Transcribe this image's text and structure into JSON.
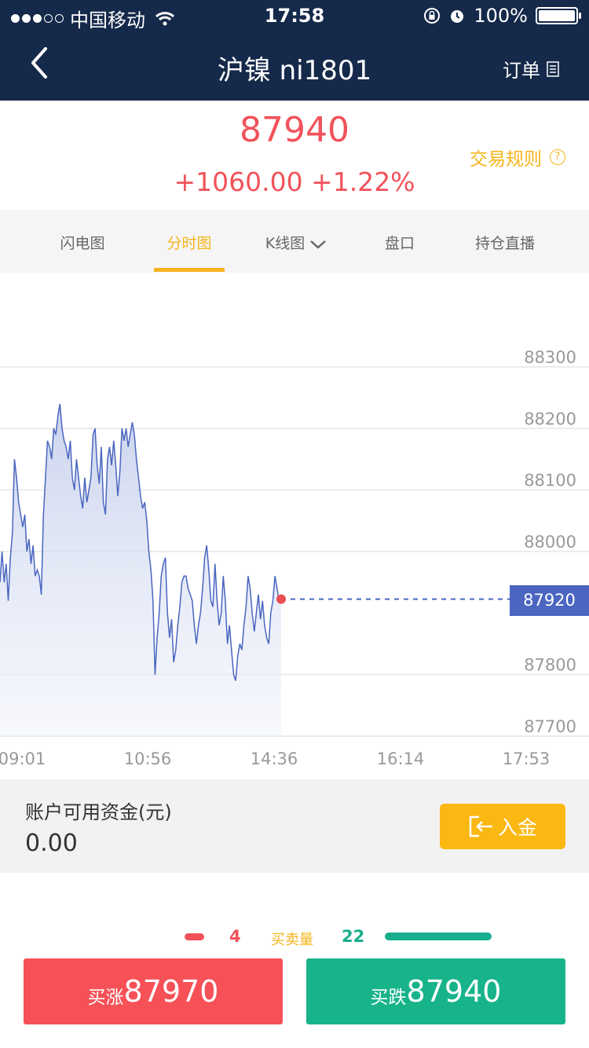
{
  "status_bar": {
    "carrier": "中国移动",
    "time": "17:58",
    "battery": "100%",
    "signal_bars_filled": 3,
    "signal_bars_total": 5
  },
  "nav": {
    "title": "沪镍 ni1801",
    "orders_label": "订单"
  },
  "quote": {
    "price": "87940",
    "change": "+1060.00 +1.22%",
    "rules_label": "交易规则",
    "accent_color": "#f2525a"
  },
  "tabs": [
    {
      "label": "闪电图",
      "active": false
    },
    {
      "label": "分时图",
      "active": true
    },
    {
      "label": "K线图",
      "active": false
    },
    {
      "label": "盘口",
      "active": false
    },
    {
      "label": "持仓直播",
      "active": false
    }
  ],
  "chart_data": {
    "type": "area",
    "y_ticks": [
      "88300",
      "88200",
      "88100",
      "88000",
      "87800",
      "87700"
    ],
    "x_ticks": [
      "09:01",
      "10:56",
      "14:36",
      "16:14",
      "17:53"
    ],
    "ylim": [
      87700,
      88300
    ],
    "current_price_label": "87920",
    "current_price": 87920,
    "series": [
      {
        "values": [
          87950,
          88000,
          87950,
          87980,
          87920,
          87990,
          88030,
          88150,
          88120,
          88080,
          88060,
          88040,
          88060,
          88000,
          88020,
          87980,
          88010,
          87960,
          87970,
          87960,
          87930,
          88060,
          88120,
          88180,
          88170,
          88150,
          88200,
          88190,
          88220,
          88240,
          88200,
          88180,
          88170,
          88150,
          88180,
          88120,
          88100,
          88150,
          88120,
          88090,
          88070,
          88120,
          88080,
          88100,
          88120,
          88190,
          88200,
          88140,
          88110,
          88170,
          88080,
          88060,
          88150,
          88170,
          88140,
          88180,
          88140,
          88090,
          88130,
          88200,
          88180,
          88200,
          88170,
          88190,
          88210,
          88190,
          88150,
          88120,
          88090,
          88070,
          88080,
          88050,
          88000,
          87970,
          87920,
          87800,
          87860,
          87900,
          87960,
          87980,
          87990,
          87900,
          87860,
          87890,
          87820,
          87840,
          87880,
          87910,
          87950,
          87960,
          87960,
          87940,
          87930,
          87920,
          87880,
          87850,
          87880,
          87900,
          87940,
          87990,
          88010,
          87970,
          87920,
          87910,
          87980,
          87920,
          87880,
          87900,
          87960,
          87920,
          87850,
          87880,
          87840,
          87800,
          87790,
          87830,
          87850,
          87840,
          87880,
          87910,
          87960,
          87940,
          87900,
          87870,
          87900,
          87930,
          87890,
          87920,
          87880,
          87860,
          87850,
          87900,
          87920,
          87960,
          87940,
          87920,
          87930
        ]
      }
    ],
    "grid": true
  },
  "funds": {
    "label": "账户可用资金(元)",
    "value": "0.00",
    "deposit_label": "入金"
  },
  "volume": {
    "buy_count": "4",
    "label": "买卖量",
    "sell_count": "22"
  },
  "actions": {
    "buy_up_prefix": "买涨",
    "buy_up_price": "87970",
    "buy_down_prefix": "买跌",
    "buy_down_price": "87940"
  }
}
